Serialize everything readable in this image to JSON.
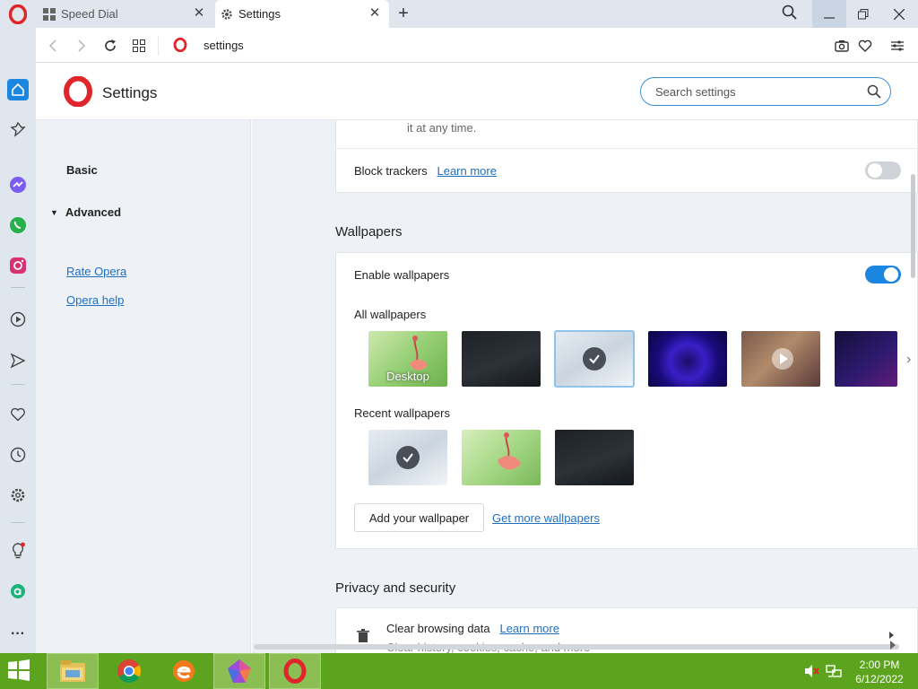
{
  "browser": {
    "tabs": [
      {
        "label": "Speed Dial"
      },
      {
        "label": "Settings"
      }
    ],
    "address": "settings"
  },
  "settings": {
    "title": "Settings",
    "search_placeholder": "Search settings",
    "nav": {
      "basic": "Basic",
      "advanced": "Advanced",
      "rate": "Rate Opera",
      "help": "Opera help"
    }
  },
  "content": {
    "tracker_fade_text": "it at any time.",
    "block_trackers": {
      "label": "Block trackers",
      "link": "Learn more",
      "enabled": false
    },
    "wallpapers": {
      "section_title": "Wallpapers",
      "enable_label": "Enable wallpapers",
      "enabled": true,
      "all_label": "All wallpapers",
      "desktop_label": "Desktop",
      "recent_label": "Recent wallpapers",
      "add_button": "Add your wallpaper",
      "more_link": "Get more wallpapers"
    },
    "privacy": {
      "section_title": "Privacy and security",
      "clear_title": "Clear browsing data",
      "clear_link": "Learn more",
      "clear_sub": "Clear history, cookies, cache, and more"
    }
  },
  "taskbar": {
    "time": "2:00 PM",
    "date": "6/12/2022"
  },
  "colors": {
    "accent": "#1a86e0",
    "opera_red": "#e0262a",
    "taskbar": "#5da41e",
    "sidebar": "#dfe6ee"
  }
}
